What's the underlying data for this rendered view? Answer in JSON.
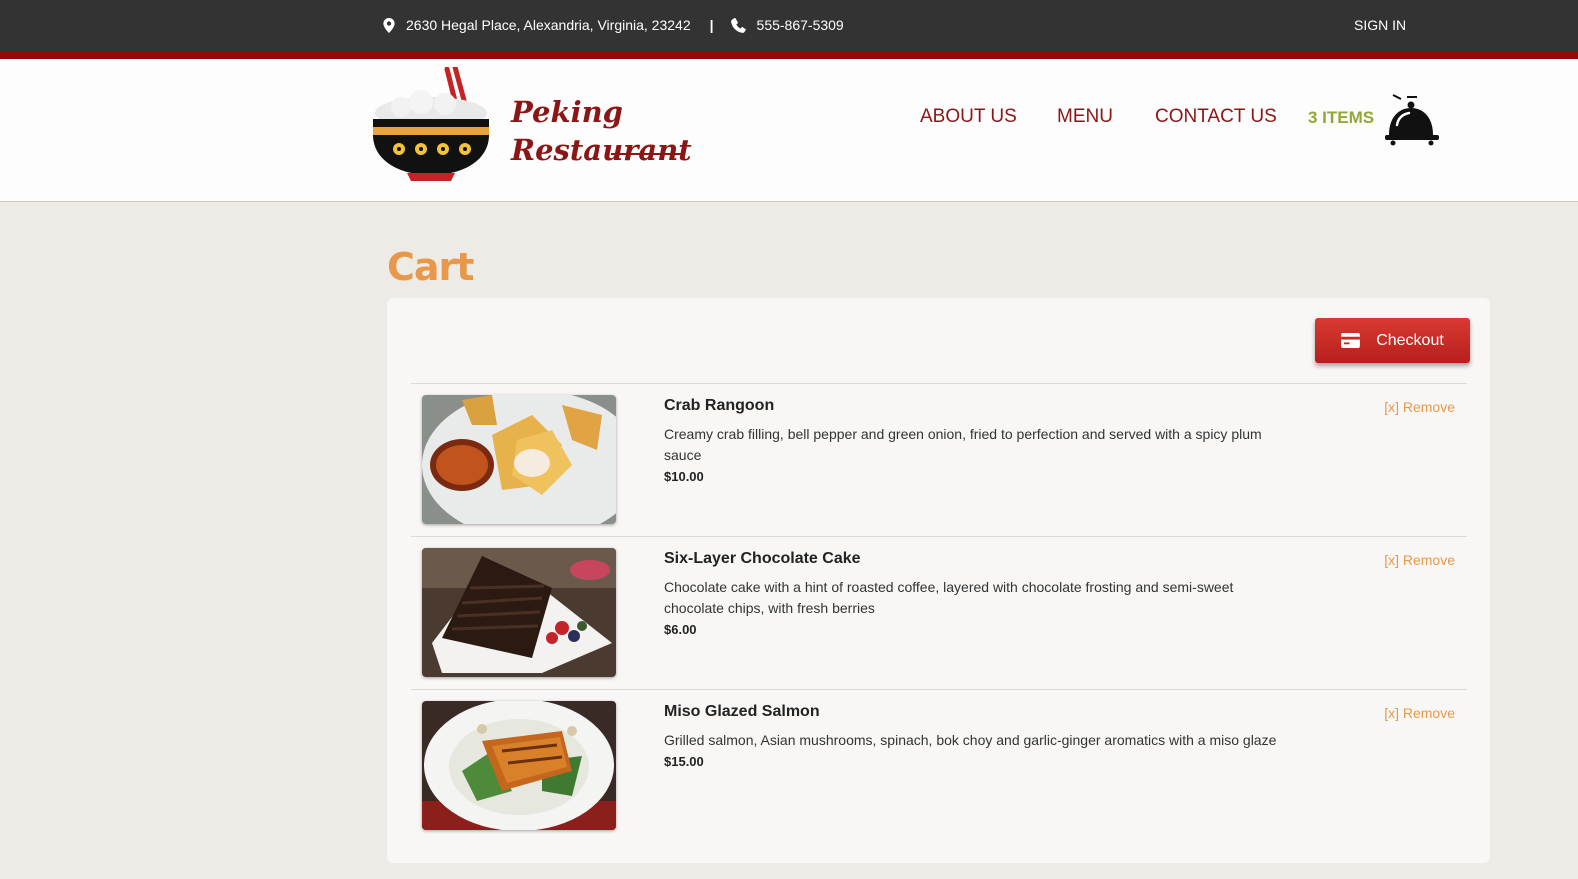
{
  "topbar": {
    "address": "2630 Hegal Place, Alexandria, Virginia, 23242",
    "separator": "|",
    "phone": "555-867-5309",
    "sign_in": "SIGN IN",
    "pin_icon": "map-marker-icon",
    "phone_icon": "phone-icon"
  },
  "header": {
    "logo_line1": "Peking",
    "logo_line2": "Restaurant",
    "nav": [
      "ABOUT US",
      "MENU",
      "CONTACT US"
    ],
    "cart_count": "3 ITEMS",
    "cart_icon": "food-cloche-icon"
  },
  "main": {
    "title": "Cart",
    "checkout_label": "Checkout",
    "checkout_icon": "credit-card-icon",
    "items": [
      {
        "name": "Crab Rangoon",
        "description": "Creamy crab filling, bell pepper and green onion, fried to perfection and served with a spicy plum sauce",
        "price": "$10.00",
        "remove": "[x] Remove"
      },
      {
        "name": "Six-Layer Chocolate Cake",
        "description": "Chocolate cake with a hint of roasted coffee, layered with chocolate frosting and semi-sweet chocolate chips, with fresh berries",
        "price": "$6.00",
        "remove": "[x] Remove"
      },
      {
        "name": "Miso Glazed Salmon",
        "description": "Grilled salmon, Asian mushrooms, spinach, bok choy and garlic-ginger aromatics with a miso glaze",
        "price": "$15.00",
        "remove": "[x] Remove"
      }
    ]
  },
  "colors": {
    "topbar": "#333333",
    "accent_red": "#8f0b0b",
    "nav_text": "#8b1616",
    "cart_count": "#8fa838",
    "title_orange": "#e8984a",
    "checkout_red": "#c62a24"
  }
}
